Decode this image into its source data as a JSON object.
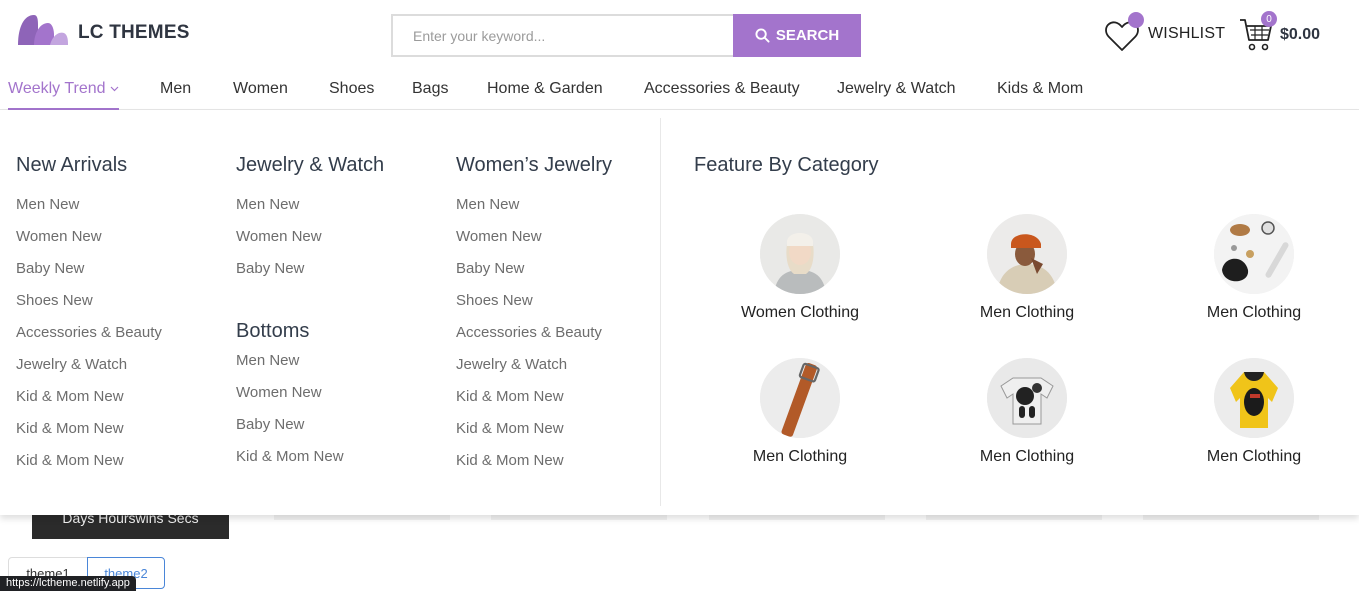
{
  "brand": {
    "name": "LC THEMES",
    "color": "#a374cc"
  },
  "search": {
    "placeholder": "Enter your keyword...",
    "button_label": "SEARCH",
    "icon": "search-icon"
  },
  "wishlist": {
    "label": "WISHLIST",
    "icon": "heart-icon"
  },
  "cart": {
    "count": "0",
    "total": "$0.00",
    "icon": "cart-icon"
  },
  "nav": {
    "items": [
      {
        "label": "Weekly Trend",
        "active": true
      },
      {
        "label": "Men"
      },
      {
        "label": "Women"
      },
      {
        "label": "Shoes"
      },
      {
        "label": "Bags"
      },
      {
        "label": "Home & Garden"
      },
      {
        "label": "Accessories & Beauty"
      },
      {
        "label": "Jewelry & Watch"
      },
      {
        "label": "Kids & Mom"
      }
    ]
  },
  "mega": {
    "new_arrivals": {
      "title": "New Arrivals",
      "links": [
        "Men New",
        "Women New",
        "Baby New",
        "Shoes New",
        "Accessories & Beauty",
        "Jewelry & Watch",
        "Kid & Mom New",
        "Kid & Mom New",
        "Kid & Mom New"
      ]
    },
    "jewelry_watch": {
      "title": "Jewelry & Watch",
      "links": [
        "Men New",
        "Women New",
        "Baby New"
      ]
    },
    "bottoms": {
      "title": "Bottoms",
      "links": [
        "Men New",
        "Women New",
        "Baby New",
        "Kid & Mom New"
      ]
    },
    "womens_jewelry": {
      "title": "Women’s Jewelry",
      "links": [
        "Men New",
        "Women New",
        "Baby New",
        "Shoes New",
        "Accessories & Beauty",
        "Jewelry & Watch",
        "Kid & Mom New",
        "Kid & Mom New",
        "Kid & Mom New"
      ]
    },
    "feature": {
      "title": "Feature By Category",
      "items": [
        {
          "label": "Women Clothing"
        },
        {
          "label": "Men Clothing"
        },
        {
          "label": "Men Clothing"
        },
        {
          "label": "Men Clothing"
        },
        {
          "label": "Men Clothing"
        },
        {
          "label": "Men Clothing"
        }
      ]
    }
  },
  "background": {
    "banner_text": "Days Hourswins Secs",
    "theme_buttons": [
      "theme1",
      "theme2"
    ]
  },
  "status_bar": {
    "url": "https://lctheme.netlify.app"
  }
}
